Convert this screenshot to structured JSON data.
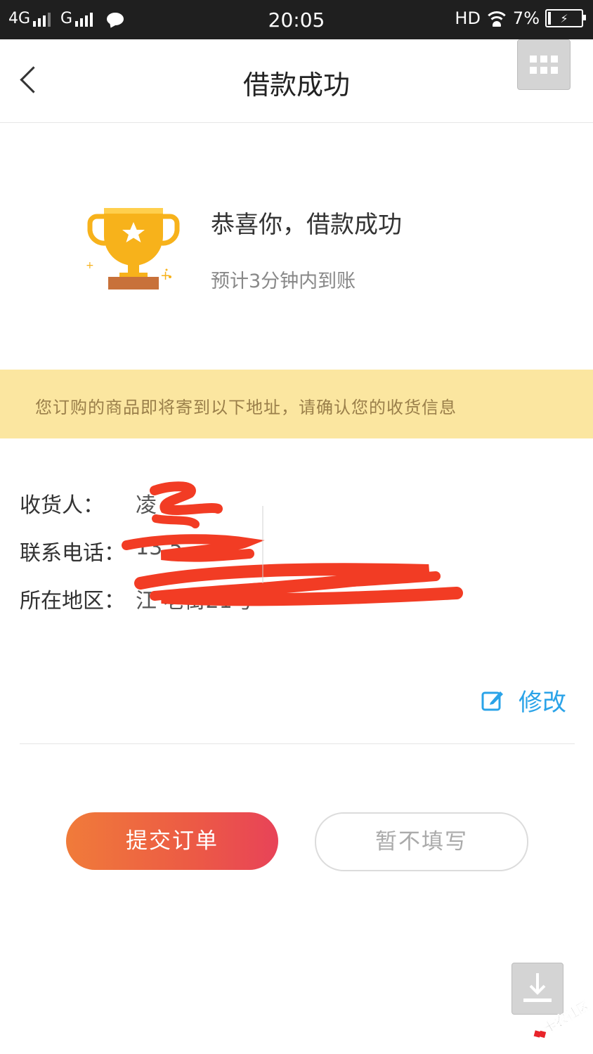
{
  "status_bar": {
    "network1": "4G",
    "network2": "G",
    "time": "20:05",
    "hd": "HD",
    "battery_percent": "7%"
  },
  "header": {
    "title": "借款成功"
  },
  "success": {
    "title": "恭喜你，借款成功",
    "subtitle": "预计3分钟内到账"
  },
  "notice": {
    "text": "您订购的商品即将寄到以下地址，请确认您的收货信息"
  },
  "address": {
    "receiver_label": "收货人：",
    "receiver_value": "凌",
    "phone_label": "联系电话：",
    "phone_value": "13          5",
    "region_label": "所在地区：",
    "region_value": "江                            老街21号"
  },
  "edit": {
    "label": "修改"
  },
  "actions": {
    "submit_label": "提交订单",
    "skip_label": "暂不填写"
  },
  "watermark": {
    "text": "卡农社区"
  },
  "colors": {
    "accent_blue": "#2aa3e8",
    "banner_bg": "#fbe6a0",
    "banner_text": "#9a7f4a",
    "primary_gradient_start": "#f07b3a",
    "primary_gradient_end": "#e84358",
    "redaction": "#f23c24"
  }
}
